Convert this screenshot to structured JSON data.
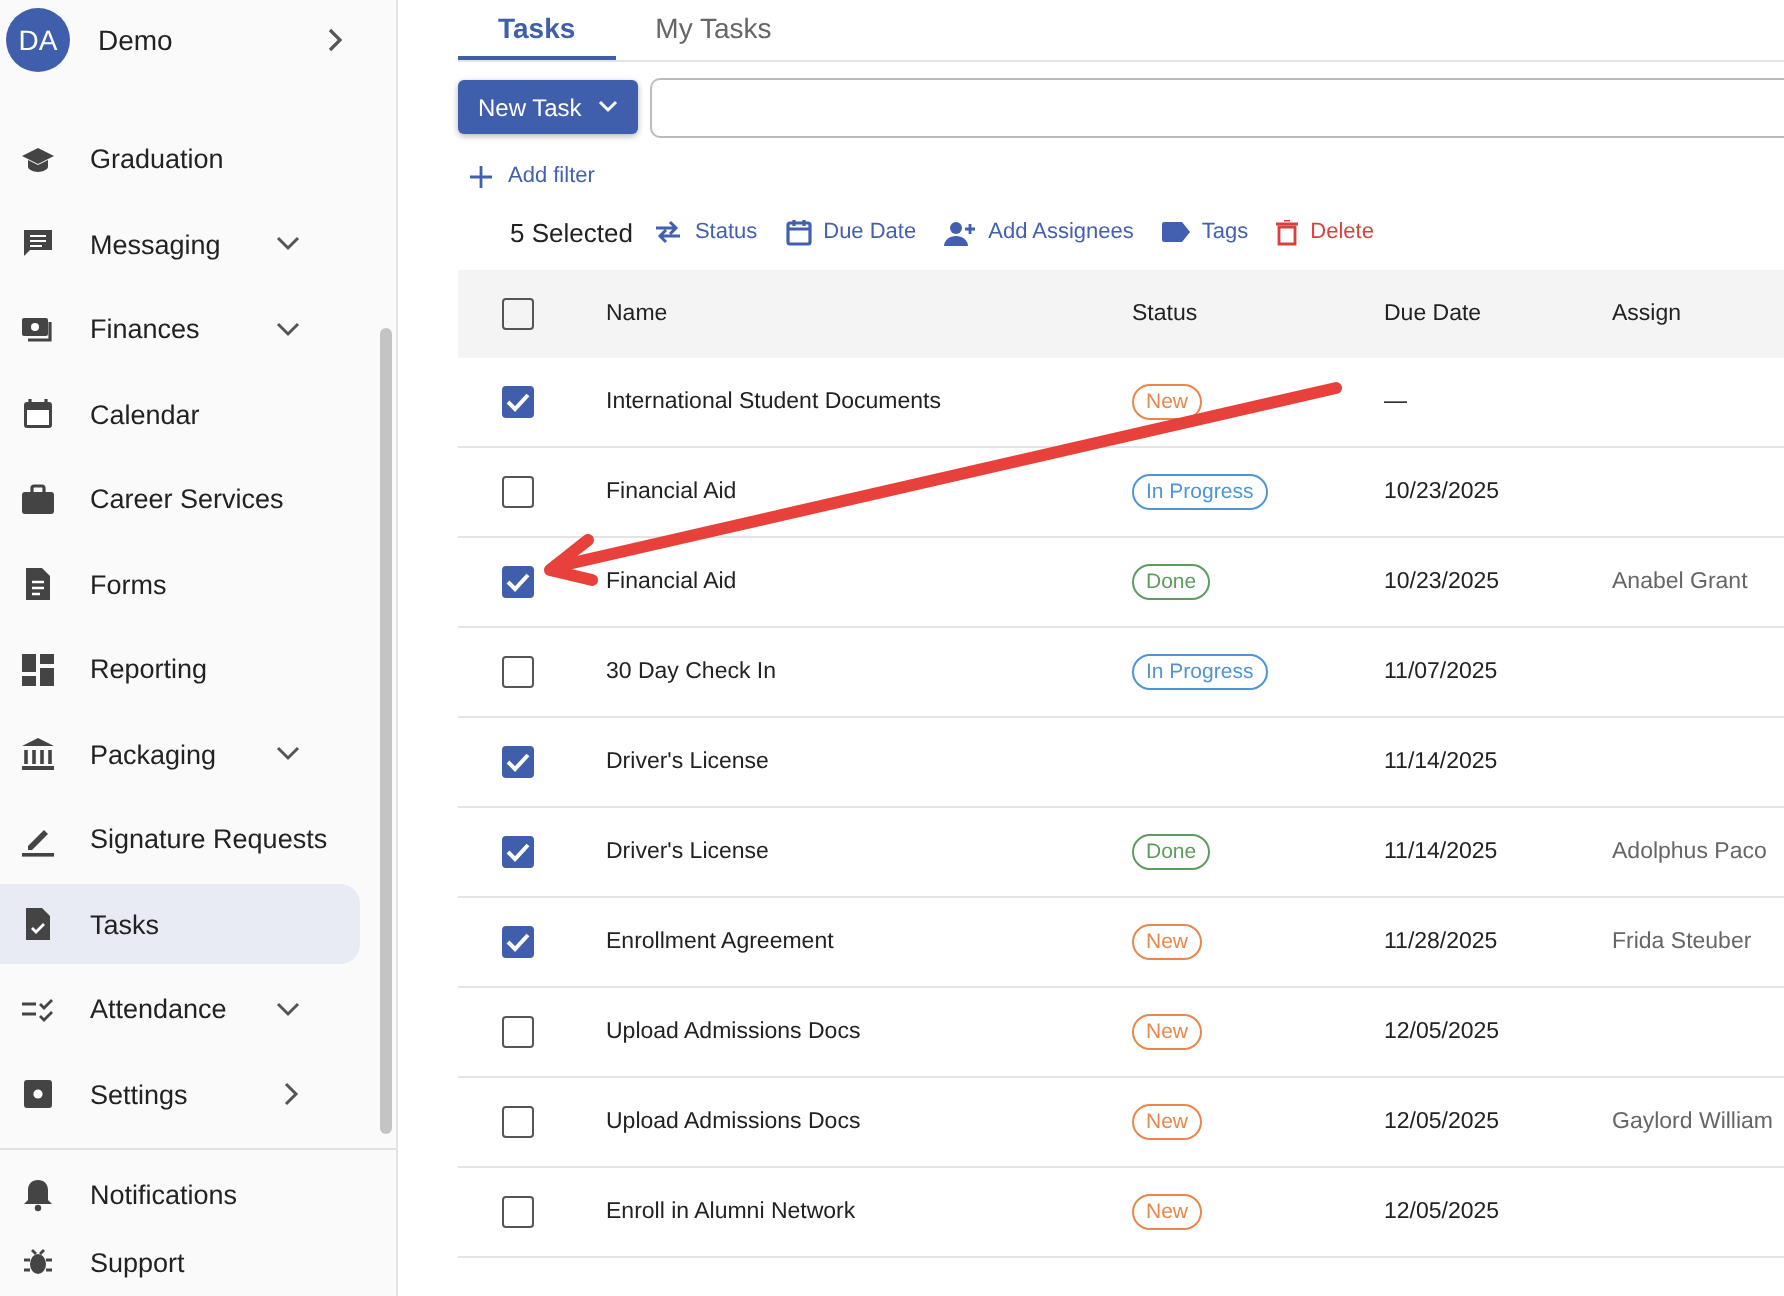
{
  "account": {
    "initials": "DA",
    "name": "Demo"
  },
  "sidebar": {
    "items": [
      {
        "label": "Graduation",
        "selected": false,
        "kind": "link"
      },
      {
        "label": "Messaging",
        "selected": false,
        "kind": "group"
      },
      {
        "label": "Finances",
        "selected": false,
        "kind": "group"
      },
      {
        "label": "Calendar",
        "selected": false,
        "kind": "link"
      },
      {
        "label": "Career Services",
        "selected": false,
        "kind": "link"
      },
      {
        "label": "Forms",
        "selected": false,
        "kind": "link"
      },
      {
        "label": "Reporting",
        "selected": false,
        "kind": "link"
      },
      {
        "label": "Packaging",
        "selected": false,
        "kind": "group"
      },
      {
        "label": "Signature Requests",
        "selected": false,
        "kind": "link"
      },
      {
        "label": "Tasks",
        "selected": true,
        "kind": "link"
      },
      {
        "label": "Attendance",
        "selected": false,
        "kind": "group"
      },
      {
        "label": "Settings",
        "selected": false,
        "kind": "submenu"
      }
    ],
    "footer_items": [
      {
        "label": "Notifications"
      },
      {
        "label": "Support"
      }
    ]
  },
  "tabs": [
    {
      "label": "Tasks",
      "selected": true
    },
    {
      "label": "My Tasks",
      "selected": false
    }
  ],
  "new_task_button": "New Task",
  "add_filter": "Add filter",
  "bulk_bar": {
    "count": "5 Selected",
    "actions": [
      {
        "label": "Status",
        "kind": "swap"
      },
      {
        "label": "Due Date",
        "kind": "date"
      },
      {
        "label": "Add Assignees",
        "kind": "person"
      },
      {
        "label": "Tags",
        "kind": "tag"
      },
      {
        "label": "Delete",
        "kind": "delete"
      }
    ]
  },
  "table": {
    "all_checked": false,
    "columns": [
      "Name",
      "Status",
      "Due Date",
      "Assign"
    ],
    "rows": [
      {
        "checked": true,
        "name": "International Student Documents",
        "status": {
          "label": "New",
          "color": "#e8874c"
        },
        "due": "—",
        "assignee": ""
      },
      {
        "checked": false,
        "name": "Financial Aid",
        "status": {
          "label": "In Progress",
          "color": "#4f93d8"
        },
        "due": "10/23/2025",
        "assignee": ""
      },
      {
        "checked": true,
        "name": "Financial Aid",
        "status": {
          "label": "Done",
          "color": "#5e9c5e"
        },
        "due": "10/23/2025",
        "assignee": "Anabel Grant"
      },
      {
        "checked": false,
        "name": "30 Day Check In",
        "status": {
          "label": "In Progress",
          "color": "#4f93d8"
        },
        "due": "11/07/2025",
        "assignee": ""
      },
      {
        "checked": true,
        "name": "Driver's License",
        "status": null,
        "due": "11/14/2025",
        "assignee": ""
      },
      {
        "checked": true,
        "name": "Driver's License",
        "status": {
          "label": "Done",
          "color": "#5e9c5e"
        },
        "due": "11/14/2025",
        "assignee": "Adolphus Paco"
      },
      {
        "checked": true,
        "name": "Enrollment Agreement",
        "status": {
          "label": "New",
          "color": "#e8874c"
        },
        "due": "11/28/2025",
        "assignee": "Frida Steuber"
      },
      {
        "checked": false,
        "name": "Upload Admissions Docs",
        "status": {
          "label": "New",
          "color": "#e8874c"
        },
        "due": "12/05/2025",
        "assignee": ""
      },
      {
        "checked": false,
        "name": "Upload Admissions Docs",
        "status": {
          "label": "New",
          "color": "#e8874c"
        },
        "due": "12/05/2025",
        "assignee": "Gaylord William"
      },
      {
        "checked": false,
        "name": "Enroll in Alumni Network",
        "status": {
          "label": "New",
          "color": "#e8874c"
        },
        "due": "12/05/2025",
        "assignee": ""
      }
    ]
  }
}
